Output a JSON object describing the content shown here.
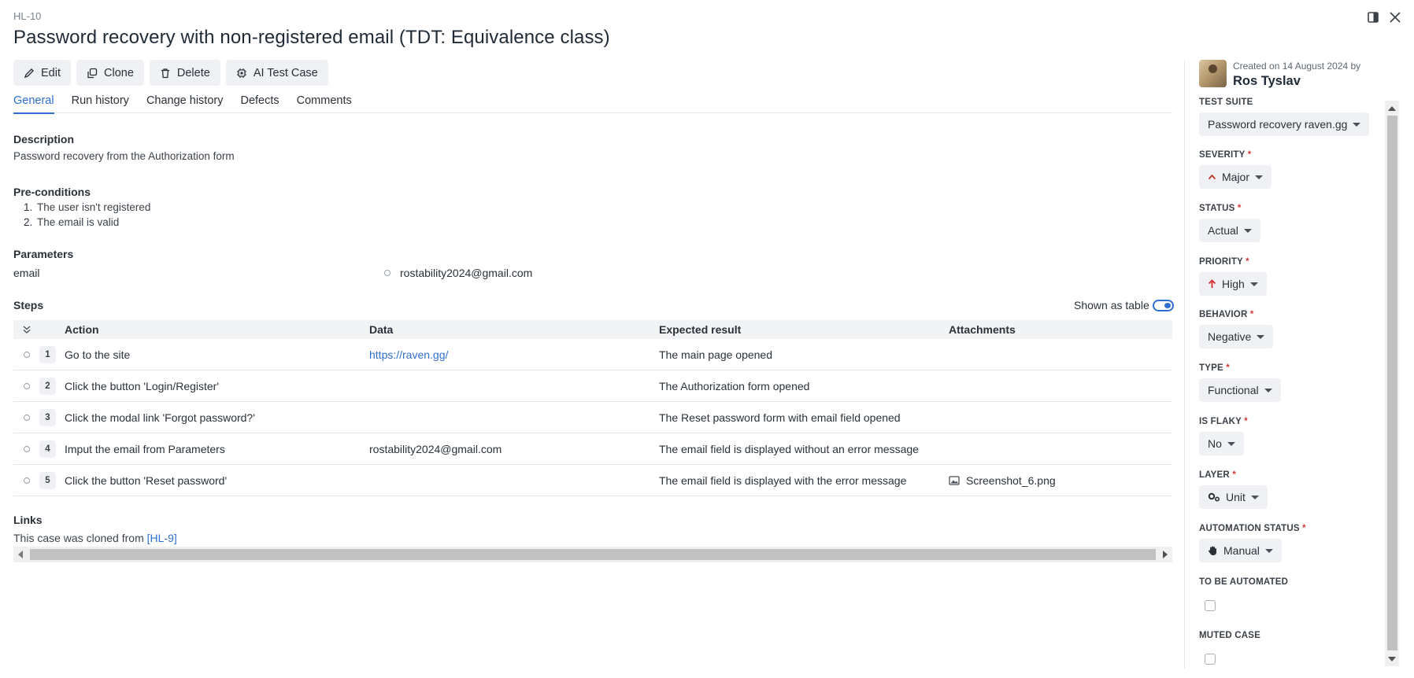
{
  "case": {
    "key": "HL-10",
    "title": "Password recovery with non-registered email (TDT: Equivalence class)"
  },
  "window": {
    "panel_icon": "panel-toggle-icon",
    "close_icon": "close-icon"
  },
  "toolbar": {
    "edit": "Edit",
    "clone": "Clone",
    "delete": "Delete",
    "ai": "AI Test Case"
  },
  "tabs": [
    {
      "label": "General",
      "active": true
    },
    {
      "label": "Run history",
      "active": false
    },
    {
      "label": "Change history",
      "active": false
    },
    {
      "label": "Defects",
      "active": false
    },
    {
      "label": "Comments",
      "active": false
    }
  ],
  "description": {
    "heading": "Description",
    "text": "Password recovery from the Authorization form"
  },
  "preconditions": {
    "heading": "Pre-conditions",
    "items": [
      {
        "num": "1.",
        "text": "The user isn't registered"
      },
      {
        "num": "2.",
        "text": "The email is valid"
      }
    ]
  },
  "parameters": {
    "heading": "Parameters",
    "name": "email",
    "value": "rostability2024@gmail.com"
  },
  "steps": {
    "heading": "Steps",
    "toggle_label": "Shown as table",
    "toggle_on": true,
    "columns": {
      "action": "Action",
      "data": "Data",
      "expected": "Expected result",
      "attachments": "Attachments"
    },
    "rows": [
      {
        "num": "1",
        "action": "Go to the site",
        "data": "https://raven.gg/",
        "data_is_link": true,
        "expected": "The main page opened",
        "attachment": ""
      },
      {
        "num": "2",
        "action": "Click the button 'Login/Register'",
        "data": "",
        "data_is_link": false,
        "expected": "The Authorization form opened",
        "attachment": ""
      },
      {
        "num": "3",
        "action": "Click the modal link 'Forgot password?'",
        "data": "",
        "data_is_link": false,
        "expected": "The Reset password form with email field opened",
        "attachment": ""
      },
      {
        "num": "4",
        "action": "Imput the email from Parameters",
        "data": "rostability2024@gmail.com",
        "data_is_link": false,
        "expected": "The email field is displayed without an error message",
        "attachment": ""
      },
      {
        "num": "5",
        "action": "Click the button 'Reset password'",
        "data": "",
        "data_is_link": false,
        "expected": "The email field is displayed with the error message",
        "attachment": "Screenshot_6.png"
      }
    ]
  },
  "links": {
    "heading": "Links",
    "text_prefix": "This case was cloned from ",
    "link": "[HL-9]"
  },
  "sidebar": {
    "created_text": "Created on 14 August 2024 by",
    "author": "Ros Tyslav",
    "properties": [
      {
        "label": "TEST SUITE",
        "required": false,
        "value": "Password recovery raven.gg",
        "icon": ""
      },
      {
        "label": "SEVERITY",
        "required": true,
        "value": "Major",
        "icon": "chevron-up-icon"
      },
      {
        "label": "STATUS",
        "required": true,
        "value": "Actual",
        "icon": ""
      },
      {
        "label": "PRIORITY",
        "required": true,
        "value": "High",
        "icon": "arrow-up-icon"
      },
      {
        "label": "BEHAVIOR",
        "required": true,
        "value": "Negative",
        "icon": ""
      },
      {
        "label": "TYPE",
        "required": true,
        "value": "Functional",
        "icon": ""
      },
      {
        "label": "IS FLAKY",
        "required": true,
        "value": "No",
        "icon": ""
      },
      {
        "label": "LAYER",
        "required": true,
        "value": "Unit",
        "icon": "gears-icon"
      },
      {
        "label": "AUTOMATION STATUS",
        "required": true,
        "value": "Manual",
        "icon": "hand-icon"
      }
    ],
    "checkboxes": [
      {
        "label": "TO BE AUTOMATED",
        "checked": false
      },
      {
        "label": "MUTED CASE",
        "checked": false
      }
    ]
  },
  "colors": {
    "accent": "#2f6fd1",
    "required": "#d33a3a",
    "severity": "#c0392b",
    "priority": "#d62f2f"
  }
}
